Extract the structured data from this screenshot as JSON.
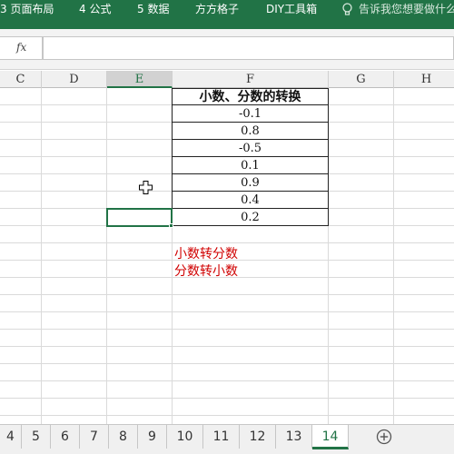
{
  "ribbon": {
    "tabs": [
      "3 页面布局",
      "4 公式",
      "5 数据",
      "方方格子",
      "DIY工具箱"
    ],
    "tell_me": "告诉我您想要做什么"
  },
  "formula_bar": {
    "fx_label": "fx",
    "value": ""
  },
  "columns": [
    "C",
    "D",
    "E",
    "F",
    "G",
    "H"
  ],
  "selected_column": "E",
  "table": {
    "header": "小数、分数的转换",
    "values": [
      "-0.1",
      "0.8",
      "-0.5",
      "0.1",
      "0.9",
      "0.4",
      "0.2"
    ]
  },
  "notes": [
    "小数转分数",
    "分数转小数"
  ],
  "sheet_tabs": [
    "4",
    "5",
    "6",
    "7",
    "8",
    "9",
    "10",
    "11",
    "12",
    "13",
    "14"
  ],
  "active_sheet": "14",
  "colors": {
    "excel_green": "#217346",
    "note_red": "#d00000"
  }
}
